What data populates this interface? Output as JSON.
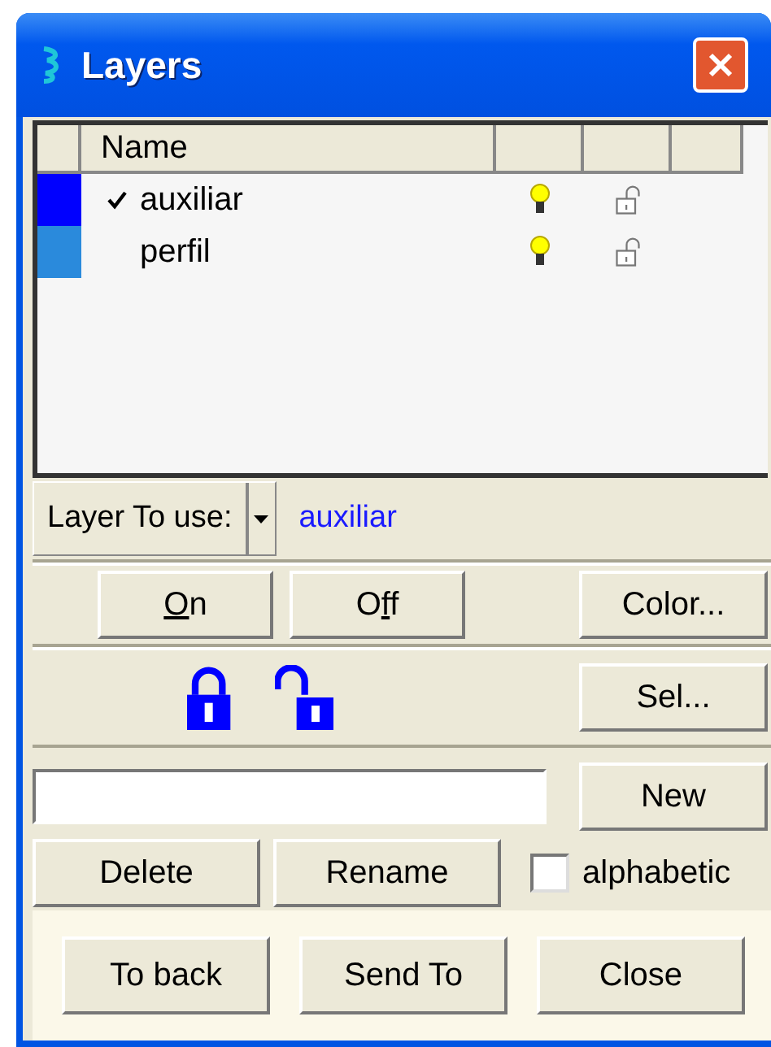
{
  "window": {
    "title": "Layers"
  },
  "table": {
    "columns": [
      "Name"
    ],
    "rows": [
      {
        "color": "#0000ff",
        "selected": true,
        "name": "auxiliar",
        "visible": true,
        "locked": false
      },
      {
        "color": "#2a8adc",
        "selected": false,
        "name": "perfil",
        "visible": true,
        "locked": false
      }
    ]
  },
  "layer_to_use": {
    "label": "Layer To use:",
    "value": "auxiliar"
  },
  "state_buttons": [
    {
      "key": "O",
      "after": "n"
    },
    {
      "before": "O",
      "key": "f",
      "after": "f"
    }
  ],
  "color_button": "Color...",
  "select_button": "Sel...",
  "new_button": "New",
  "action_buttons": [
    "Delete",
    "Rename"
  ],
  "alphabetic": {
    "label": "alphabetic",
    "checked": false
  },
  "footer_buttons": [
    "To back",
    "Send To",
    "Close"
  ]
}
